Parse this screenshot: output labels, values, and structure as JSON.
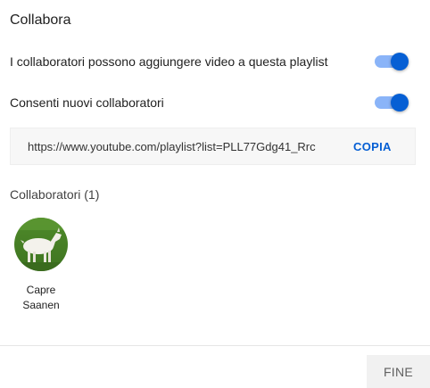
{
  "dialog": {
    "title": "Collabora"
  },
  "settings": {
    "allow_add_label": "I collaboratori possono aggiungere video a questa playlist",
    "allow_add_on": true,
    "allow_new_label": "Consenti nuovi collaboratori",
    "allow_new_on": true
  },
  "invite": {
    "link": "https://www.youtube.com/playlist?list=PLL77Gdg41_Rrc",
    "copy_label": "COPIA"
  },
  "collaborators": {
    "heading": "Collaboratori (1)",
    "items": [
      {
        "name": "Capre Saanen"
      }
    ]
  },
  "footer": {
    "done_label": "FINE"
  },
  "colors": {
    "accent": "#065fd4",
    "track": "#8ab4f8"
  }
}
